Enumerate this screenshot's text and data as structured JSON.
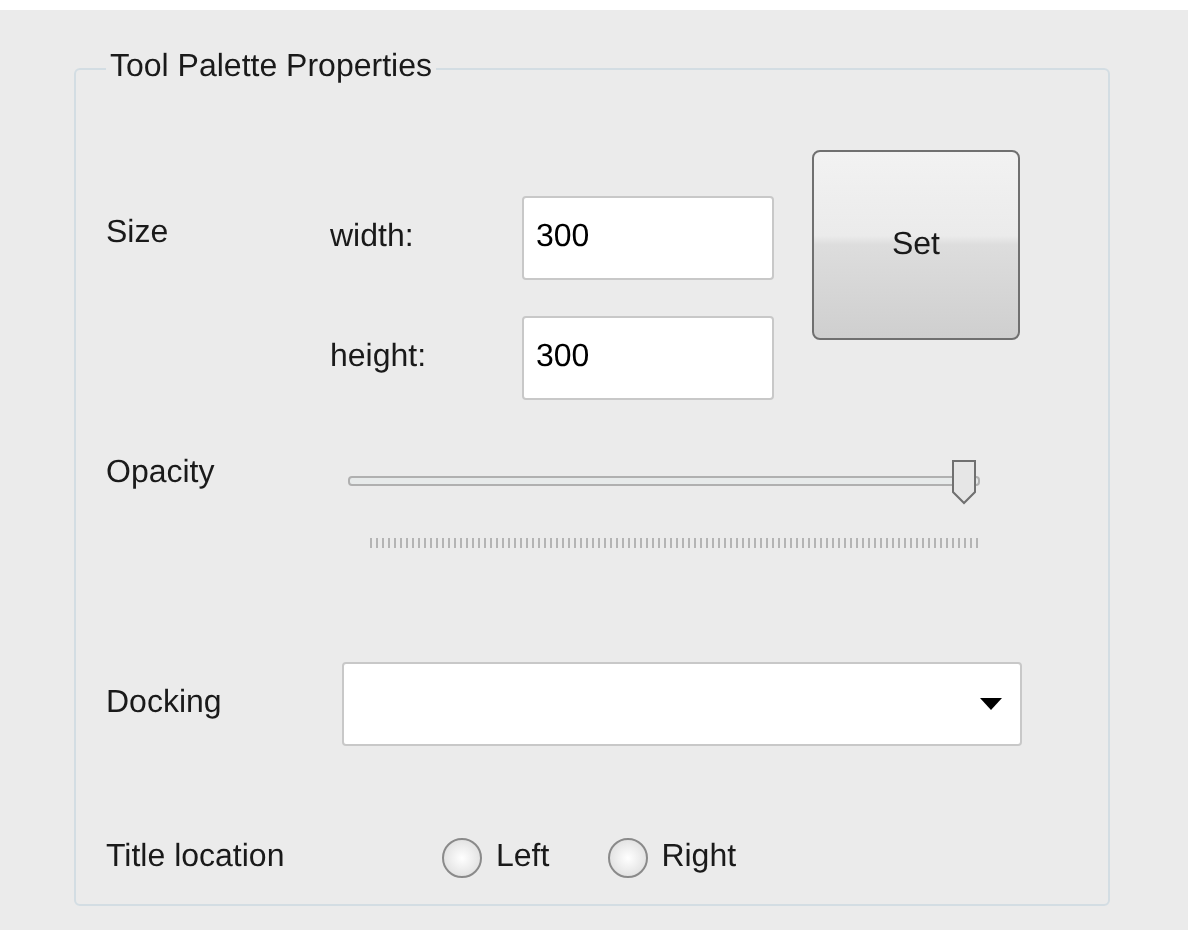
{
  "group": {
    "title": "Tool Palette Properties"
  },
  "size": {
    "label": "Size",
    "fields": [
      {
        "label": "width:",
        "value": "300"
      },
      {
        "label": "height:",
        "value": "300"
      }
    ],
    "button": "Set"
  },
  "opacity": {
    "label": "Opacity",
    "level": 1
  },
  "docking": {
    "label": "Docking"
  },
  "title_location": {
    "label": "Title location",
    "options": [
      {
        "label": "Left",
        "selected": false
      },
      {
        "label": "Right",
        "selected": false
      }
    ]
  }
}
